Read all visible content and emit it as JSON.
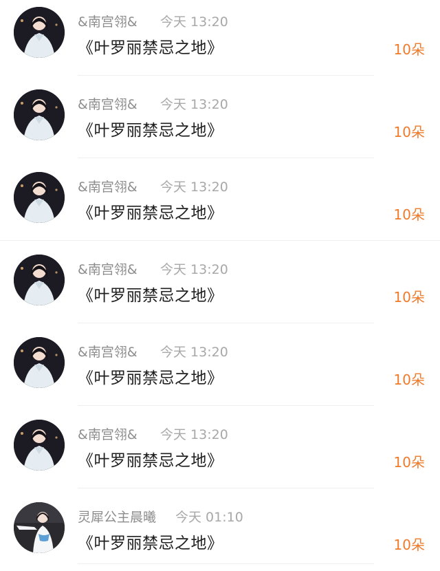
{
  "messages": [
    {
      "username": "&南宫翎&",
      "time": "今天 13:20",
      "content": "《叶罗丽禁忌之地》",
      "count": "10朵"
    },
    {
      "username": "&南宫翎&",
      "time": "今天 13:20",
      "content": "《叶罗丽禁忌之地》",
      "count": "10朵"
    },
    {
      "username": "&南宫翎&",
      "time": "今天 13:20",
      "content": "《叶罗丽禁忌之地》",
      "count": "10朵"
    },
    {
      "username": "&南宫翎&",
      "time": "今天 13:20",
      "content": "《叶罗丽禁忌之地》",
      "count": "10朵"
    },
    {
      "username": "&南宫翎&",
      "time": "今天 13:20",
      "content": "《叶罗丽禁忌之地》",
      "count": "10朵"
    },
    {
      "username": "&南宫翎&",
      "time": "今天 13:20",
      "content": "《叶罗丽禁忌之地》",
      "count": "10朵"
    },
    {
      "username": "灵犀公主晨曦",
      "time": "今天 01:10",
      "content": "《叶罗丽禁忌之地》",
      "count": "10朵"
    }
  ],
  "colors": {
    "username": "#8d8d8d",
    "timestamp": "#a8a8a8",
    "content": "#1f1f1f",
    "count_accent": "#ef7b2a",
    "divider": "#eeeeee"
  }
}
